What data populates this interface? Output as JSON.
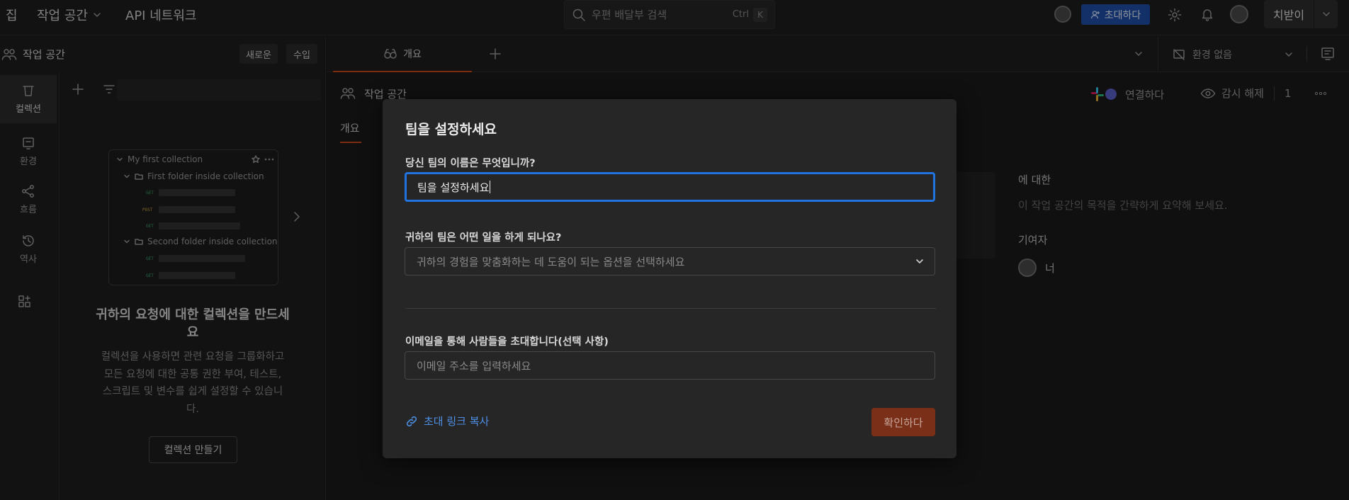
{
  "topbar": {
    "home": "집",
    "workspace_menu": "작업 공간",
    "api_network": "API 네트워크",
    "search_placeholder": "우편 배달부 검색",
    "search_shortcut_ctrl": "Ctrl",
    "search_shortcut_key": "K",
    "invite_label": "초대하다",
    "user_name": "치받이"
  },
  "left": {
    "workspace_title": "작업 공간",
    "new_button": "새로운",
    "import_button": "수입",
    "sidebar": [
      {
        "label": "컬렉션"
      },
      {
        "label": "환경"
      },
      {
        "label": "흐름"
      },
      {
        "label": "역사"
      }
    ],
    "collection_preview": {
      "name": "My first collection",
      "folder1": "First folder inside collection",
      "folder2": "Second folder inside collection",
      "methods": [
        "GET",
        "POST",
        "GET",
        "GET",
        "GET"
      ]
    },
    "empty_title": "귀하의 요청에 대한 컬렉션을 만드세요",
    "empty_desc": "컬렉션을 사용하면 관련 요청을 그룹화하고 모든 요청에 대한 공통 권한 부여, 테스트, 스크립트 및 변수를 쉽게 설정할 수 있습니다.",
    "create_button": "컬렉션 만들기"
  },
  "main": {
    "tab_label": "개요",
    "environment": "환경 없음",
    "ws_title": "작업 공간",
    "connect_label": "연결하다",
    "unwatch_label": "감시 해제",
    "watch_count": "1",
    "overview_tab": "개요",
    "about_title": "에 대한",
    "about_placeholder": "이 작업 공간의 목적을 간략하게 요약해 보세요.",
    "contributors_title": "기여자",
    "contributor_name": "너"
  },
  "modal": {
    "title": "팀을 설정하세요",
    "name_label": "당신 팀의 이름은 무엇입니까?",
    "name_value": "팀을 설정하세요",
    "role_label": "귀하의 팀은 어떤 일을 하게 되나요?",
    "role_placeholder": "귀하의 경험을 맞춤화하는 데 도움이 되는 옵션을 선택하세요",
    "email_label": "이메일을 통해 사람들을 초대합니다(선택 사항)",
    "email_placeholder": "이메일 주소를 입력하세요",
    "copy_link": "초대 링크 복사",
    "confirm": "확인하다"
  },
  "colors": {
    "accent_blue": "#1f74e0",
    "confirm_orange": "#7a3018",
    "invite_blue": "#1f4ea8"
  }
}
